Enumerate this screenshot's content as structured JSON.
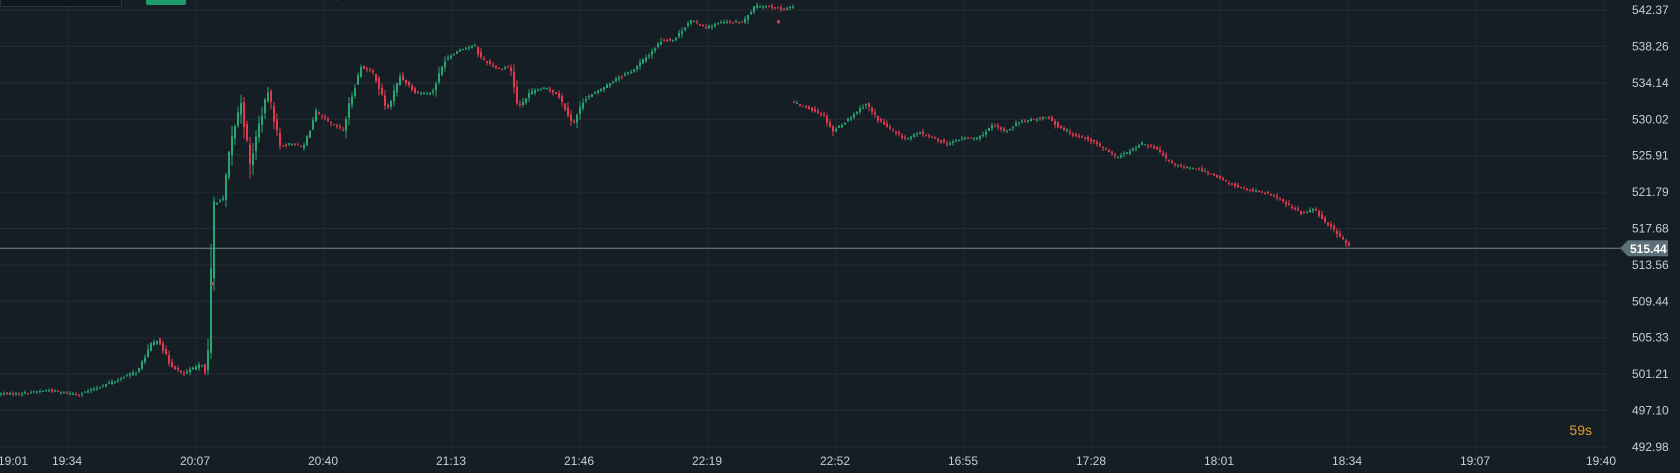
{
  "chart_data": {
    "type": "candlestick",
    "ylim": [
      492.98,
      542.37
    ],
    "y_ticks": [
      542.37,
      538.26,
      534.14,
      530.02,
      525.91,
      521.79,
      517.68,
      513.56,
      509.44,
      505.33,
      501.21,
      497.1,
      492.98
    ],
    "y_tick_labels": [
      "542.37",
      "538.26",
      "534.14",
      "530.02",
      "525.91",
      "521.79",
      "517.68",
      "513.56",
      "509.44",
      "505.33",
      "501.21",
      "497.10",
      "492.98"
    ],
    "x_tick_labels": [
      "19:01",
      "19:34",
      "20:07",
      "20:40",
      "21:13",
      "21:46",
      "22:19",
      "22:52",
      "16:55",
      "17:28",
      "18:01",
      "18:34",
      "19:07",
      "19:40"
    ],
    "current_price": 515.44,
    "current_price_label": "515.44",
    "grid": true,
    "colors": {
      "up": "#26a672",
      "down": "#e2394e",
      "grid": "#222c34",
      "price_line": "#6e8793",
      "axis_text": "#c8ced3",
      "background": "#161e25"
    },
    "series": [
      {
        "session": "day1",
        "anchors": [
          [
            0,
            499.0
          ],
          [
            20,
            499.0
          ],
          [
            50,
            499.4
          ],
          [
            80,
            498.9
          ],
          [
            100,
            499.7
          ],
          [
            120,
            500.6
          ],
          [
            140,
            501.6
          ],
          [
            152,
            504.4
          ],
          [
            160,
            505.2
          ],
          [
            172,
            502.3
          ],
          [
            185,
            501.2
          ],
          [
            198,
            502.0
          ],
          [
            205,
            502.4
          ],
          [
            209,
            500.8
          ],
          [
            216,
            520.5
          ],
          [
            225,
            521.0
          ],
          [
            233,
            527.5
          ],
          [
            243,
            532.0
          ],
          [
            252,
            524.8
          ],
          [
            260,
            529.0
          ],
          [
            270,
            533.2
          ],
          [
            282,
            527.0
          ],
          [
            294,
            527.3
          ],
          [
            305,
            526.8
          ],
          [
            318,
            530.8
          ],
          [
            333,
            529.5
          ],
          [
            345,
            528.8
          ],
          [
            352,
            532.0
          ],
          [
            363,
            536.0
          ],
          [
            376,
            535.2
          ],
          [
            389,
            531.0
          ],
          [
            402,
            534.9
          ],
          [
            418,
            533.0
          ],
          [
            434,
            533.0
          ],
          [
            447,
            536.8
          ],
          [
            463,
            538.0
          ],
          [
            477,
            538.3
          ],
          [
            482,
            537.0
          ],
          [
            500,
            535.7
          ],
          [
            512,
            536.0
          ],
          [
            520,
            531.3
          ],
          [
            532,
            533.0
          ],
          [
            548,
            533.6
          ],
          [
            560,
            532.8
          ],
          [
            575,
            529.5
          ],
          [
            586,
            532.3
          ],
          [
            600,
            533.2
          ],
          [
            618,
            534.6
          ],
          [
            635,
            535.6
          ],
          [
            650,
            537.2
          ],
          [
            664,
            539.0
          ],
          [
            676,
            539.0
          ],
          [
            692,
            541.2
          ],
          [
            708,
            540.4
          ],
          [
            725,
            541.0
          ],
          [
            745,
            541.0
          ],
          [
            757,
            542.8
          ],
          [
            772,
            542.8
          ],
          [
            785,
            542.4
          ],
          [
            792,
            542.7
          ]
        ],
        "isolated_points": [
          [
            212,
            511.5
          ],
          [
            778,
            541.1
          ]
        ]
      },
      {
        "session": "day2",
        "anchors": [
          [
            793,
            532.0
          ],
          [
            812,
            531.2
          ],
          [
            825,
            530.5
          ],
          [
            835,
            528.7
          ],
          [
            850,
            530.0
          ],
          [
            868,
            531.8
          ],
          [
            880,
            530.0
          ],
          [
            895,
            528.6
          ],
          [
            908,
            527.8
          ],
          [
            922,
            528.5
          ],
          [
            937,
            527.8
          ],
          [
            950,
            527.2
          ],
          [
            965,
            527.9
          ],
          [
            980,
            527.9
          ],
          [
            995,
            529.3
          ],
          [
            1008,
            528.6
          ],
          [
            1020,
            529.7
          ],
          [
            1035,
            530.0
          ],
          [
            1050,
            530.3
          ],
          [
            1060,
            529.2
          ],
          [
            1075,
            528.3
          ],
          [
            1090,
            527.8
          ],
          [
            1105,
            526.8
          ],
          [
            1118,
            525.7
          ],
          [
            1132,
            526.4
          ],
          [
            1145,
            527.3
          ],
          [
            1158,
            526.7
          ],
          [
            1170,
            525.3
          ],
          [
            1185,
            524.6
          ],
          [
            1200,
            524.4
          ],
          [
            1215,
            523.8
          ],
          [
            1230,
            522.8
          ],
          [
            1245,
            522.2
          ],
          [
            1260,
            521.8
          ],
          [
            1275,
            521.5
          ],
          [
            1290,
            520.3
          ],
          [
            1305,
            519.3
          ],
          [
            1315,
            520.0
          ],
          [
            1325,
            518.7
          ],
          [
            1338,
            517.3
          ],
          [
            1350,
            515.7
          ]
        ]
      }
    ]
  },
  "timer_label": "59s"
}
